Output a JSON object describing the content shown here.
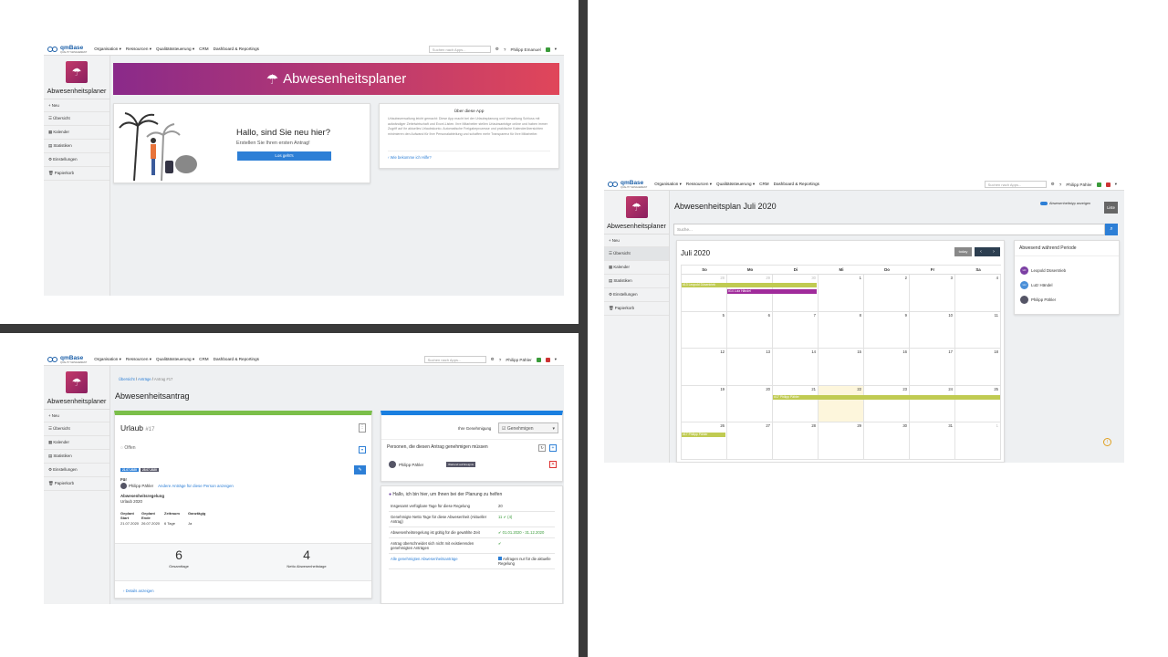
{
  "nav": {
    "logo": "qmBase",
    "logo_sub": "QUALITY MANAGEMENT",
    "menu": [
      "Organisation ▾",
      "Ressourcen ▾",
      "Qualitätssteuerung ▾",
      "CRM",
      "Dashboard & Reportings"
    ],
    "search_placeholder": "Suchen nach Apps...",
    "user1": "Philipp Emanuel",
    "user2": "Philipp Pähler"
  },
  "sidebar": {
    "app_title": "Abwesenheitsplaner",
    "items": [
      "Neu",
      "Übersicht",
      "Kalender",
      "Statistiken",
      "Einstellungen",
      "Papierkorb"
    ]
  },
  "screen1": {
    "banner_title": "Abwesenheitsplaner",
    "welcome_title": "Hallo, sind Sie neu hier?",
    "welcome_sub": "Erstellen Sie Ihren ersten Antrag!",
    "start_button": "Los geht's",
    "about_title": "Über diese App",
    "about_text": "Urlaubsverwaltung leicht gemacht: Diese App macht bei der Urlaubsplanung und Verwaltung Schluss mit aufwändiger Zettelwirtschaft und Excel-Listen. Ihre Mitarbeiter stellen Urlaubsanträge online und haben immer Zugriff auf ihr aktuelles Urlaubskonto. Automatische Freigabeprozesse und praktische Kalenderübersichten minimieren den Aufwand für Ihre Personalabteilung und schaffen mehr Transparenz für Ihre Mitarbeiter.",
    "help_link": "Wie bekomme ich Hilfe?"
  },
  "screen2": {
    "breadcrumb": [
      "Übersicht",
      "Anträge",
      "Antrag #17"
    ],
    "page_title": "Abwesenheitsantrag",
    "type": "Urlaub",
    "number": "#17",
    "status": "Offen",
    "tag_start": "21.07.2020",
    "tag_end": "25.07.2020",
    "for_label": "Für",
    "person": "Philipp Pähler",
    "other_requests_link": "Andere Anträge für diese Person anzeigen",
    "rule_label": "Abwesenheitsregelung",
    "rule_value": "Urlaub 2020",
    "col_headers": [
      "Geplant Start",
      "Geplant Ende",
      "Zeitraum",
      "Ganztägig"
    ],
    "col_values": [
      "21.07.2020",
      "26.07.2020",
      "6 Tage",
      "Ja"
    ],
    "total_days": "6",
    "total_days_label": "Gesamttage",
    "net_days": "4",
    "net_days_label": "Netto Abwesenheitstage",
    "details_link": "Details anzeigen",
    "approval_label": "Ihre Genehmigung",
    "approve_button": "Genehmigen",
    "approvers_title": "Personen, die diesen Antrag genehmigen müssen",
    "approver_name": "Philipp Pähler",
    "approver_badge": "Wartend auf Ereignis",
    "helper_title": "Hallo, ich bin hier, um Ihnen bei der Planung zu helfen",
    "rules": [
      {
        "label": "Insgesamt verfügbare Tage für diese Regelung",
        "value": "20"
      },
      {
        "label": "Genehmigte Netto Tage für diese Abwesenheit (Aktueller Antrag)",
        "value": "11 ✔ (4)"
      },
      {
        "label": "Abwesenheitsregelung ist gültig für die gewählte Zeit",
        "value": "✔ 01.01.2020 - 31.12.2020"
      },
      {
        "label": "Antrag überschneidet sich nicht mit existierenden genehmigten Anträgen",
        "value": "✔"
      }
    ],
    "approved_link": "Alle genehmigten Abwesenheitsanträge",
    "checkbox_label": "Anfragen nur für die aktuelle Regelung"
  },
  "screen3": {
    "page_title": "Abwesenheitsplan Juli 2020",
    "toggle_label": "Abwesenheitstyp anzeigen",
    "list_button": "Liste",
    "search_placeholder": "Suche...",
    "month_title": "Juli 2020",
    "today_button": "today",
    "weekdays": [
      "So",
      "Mo",
      "Di",
      "Mi",
      "Do",
      "Fr",
      "Sa"
    ],
    "days": [
      [
        "28",
        "29",
        "30",
        "1",
        "2",
        "3",
        "4"
      ],
      [
        "5",
        "6",
        "7",
        "8",
        "9",
        "10",
        "11"
      ],
      [
        "12",
        "13",
        "14",
        "15",
        "16",
        "17",
        "18"
      ],
      [
        "19",
        "20",
        "21",
        "22",
        "23",
        "24",
        "25"
      ],
      [
        "26",
        "27",
        "28",
        "29",
        "30",
        "31",
        "1"
      ]
    ],
    "events": [
      {
        "label": "#13 Leopold Düsentrieb",
        "color": "#c0cb52"
      },
      {
        "label": "#14 Lutz Händel",
        "color": "#a02b9b"
      },
      {
        "label": "#17 Philipp Pähler",
        "color": "#c0cb52"
      },
      {
        "label": "#17 Philipp Pähler",
        "color": "#c0cb52"
      }
    ],
    "panel_title": "Abwesend während Periode",
    "people": [
      {
        "initials": "LD",
        "name": "Leopold Düsentrieb",
        "color": "#7b3fa3"
      },
      {
        "initials": "LH",
        "name": "Lutz Händel",
        "color": "#4a8fd8"
      },
      {
        "initials": "",
        "name": "Philipp Pähler",
        "color": "#556"
      }
    ]
  }
}
